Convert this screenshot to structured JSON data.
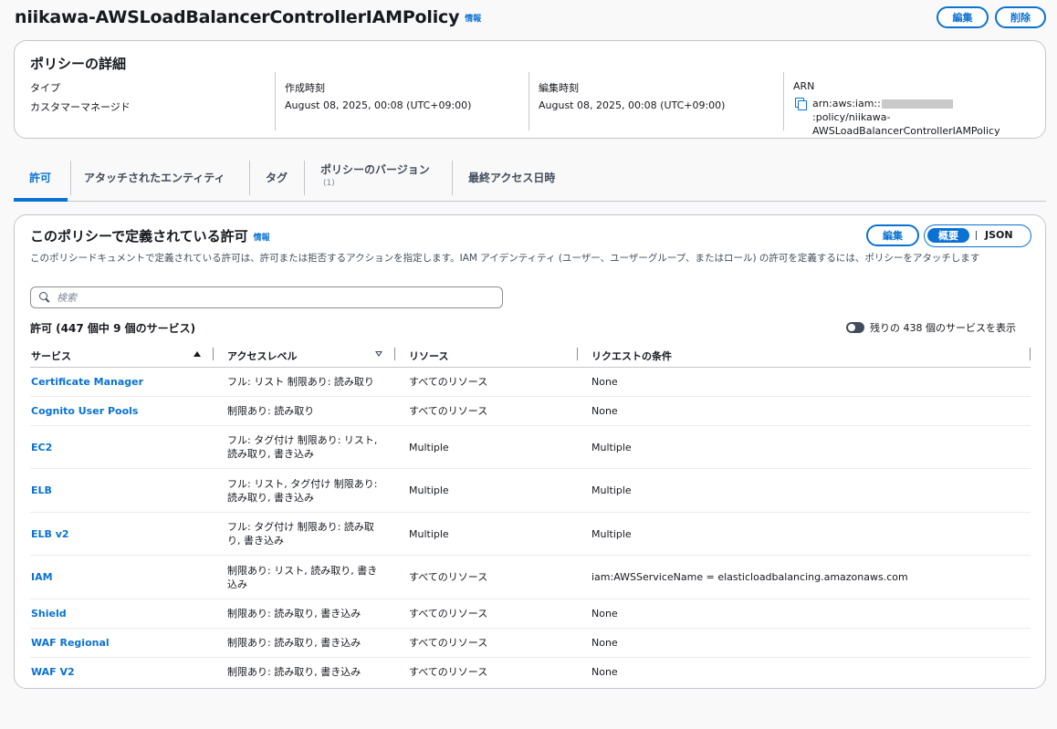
{
  "header": {
    "title": "niikawa-AWSLoadBalancerControllerIAMPolicy",
    "info": "情報",
    "edit_label": "編集",
    "delete_label": "削除"
  },
  "details": {
    "title": "ポリシーの詳細",
    "type_label": "タイプ",
    "type_value": "カスタマーマネージド",
    "created_label": "作成時刻",
    "created_value": "August 08, 2025, 00:08 (UTC+09:00)",
    "edited_label": "編集時刻",
    "edited_value": "August 08, 2025, 00:08 (UTC+09:00)",
    "arn_label": "ARN",
    "arn_prefix": "arn:aws:iam::",
    "arn_suffix": ":policy/niikawa-AWSLoadBalancerControllerIAMPolicy"
  },
  "tabs": [
    {
      "label": "許可",
      "sub": ""
    },
    {
      "label": "アタッチされたエンティティ",
      "sub": ""
    },
    {
      "label": "タグ",
      "sub": ""
    },
    {
      "label": "ポリシーのバージョン",
      "sub": "(1)"
    },
    {
      "label": "最終アクセス日時",
      "sub": ""
    }
  ],
  "permissions": {
    "title": "このポリシーで定義されている許可",
    "info": "情報",
    "description": "このポリシードキュメントで定義されている許可は、許可または拒否するアクションを指定します。IAM アイデンティティ (ユーザー、ユーザーグループ、またはロール) の許可を定義するには、ポリシーをアタッチします",
    "edit_label": "編集",
    "view_summary": "概要",
    "view_json": "JSON",
    "search_placeholder": "検索",
    "count_label": "許可 (447 個中 9 個のサービス)",
    "toggle_label": "残りの 438 個のサービスを表示",
    "columns": [
      "サービス",
      "アクセスレベル",
      "リソース",
      "リクエストの条件"
    ],
    "rows": [
      {
        "service": "Certificate Manager",
        "access": "フル: リスト 制限あり: 読み取り",
        "resource": "すべてのリソース",
        "condition": "None"
      },
      {
        "service": "Cognito User Pools",
        "access": "制限あり: 読み取り",
        "resource": "すべてのリソース",
        "condition": "None"
      },
      {
        "service": "EC2",
        "access": "フル: タグ付け 制限あり: リスト, 読み取り, 書き込み",
        "resource": "Multiple",
        "condition": "Multiple"
      },
      {
        "service": "ELB",
        "access": "フル: リスト, タグ付け 制限あり: 読み取り, 書き込み",
        "resource": "Multiple",
        "condition": "Multiple"
      },
      {
        "service": "ELB v2",
        "access": "フル: タグ付け 制限あり: 読み取り, 書き込み",
        "resource": "Multiple",
        "condition": "Multiple"
      },
      {
        "service": "IAM",
        "access": "制限あり: リスト, 読み取り, 書き込み",
        "resource": "すべてのリソース",
        "condition": "iam:AWSServiceName = elasticloadbalancing.amazonaws.com"
      },
      {
        "service": "Shield",
        "access": "制限あり: 読み取り, 書き込み",
        "resource": "すべてのリソース",
        "condition": "None"
      },
      {
        "service": "WAF Regional",
        "access": "制限あり: 読み取り, 書き込み",
        "resource": "すべてのリソース",
        "condition": "None"
      },
      {
        "service": "WAF V2",
        "access": "制限あり: 読み取り, 書き込み",
        "resource": "すべてのリソース",
        "condition": "None"
      }
    ]
  }
}
